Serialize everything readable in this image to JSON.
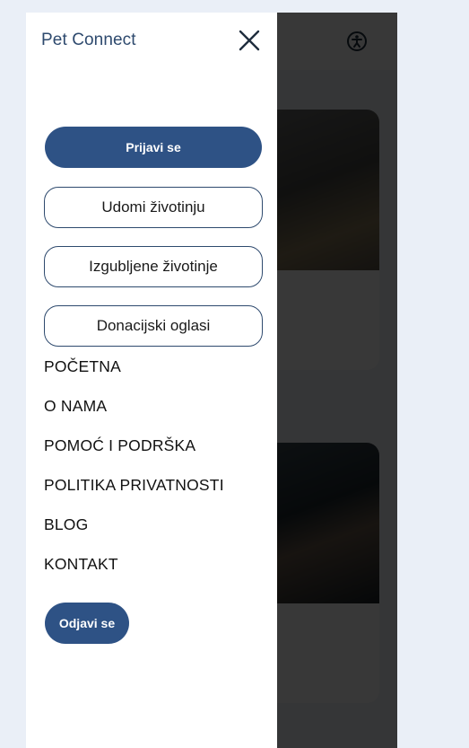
{
  "drawer": {
    "brand": "Pet Connect",
    "close_icon": "close-icon",
    "login_button": "Prijavi se",
    "buttons": [
      {
        "label": "Udomi životinju"
      },
      {
        "label": "Izgubljene životinje"
      },
      {
        "label": "Donacijski oglasi"
      }
    ],
    "nav": [
      {
        "label": "POČETNA"
      },
      {
        "label": "O NAMA"
      },
      {
        "label": "POMOĆ I PODRŠKA"
      },
      {
        "label": "POLITIKA PRIVATNOSTI"
      },
      {
        "label": "BLOG"
      },
      {
        "label": "KONTAKT"
      }
    ],
    "logout_button": "Odjavi se"
  },
  "header": {
    "accessibility_icon": "accessibility-icon"
  },
  "colors": {
    "primary": "#2e5285",
    "brand_text": "#2e4a6e",
    "page_background": "#eaeff7"
  }
}
